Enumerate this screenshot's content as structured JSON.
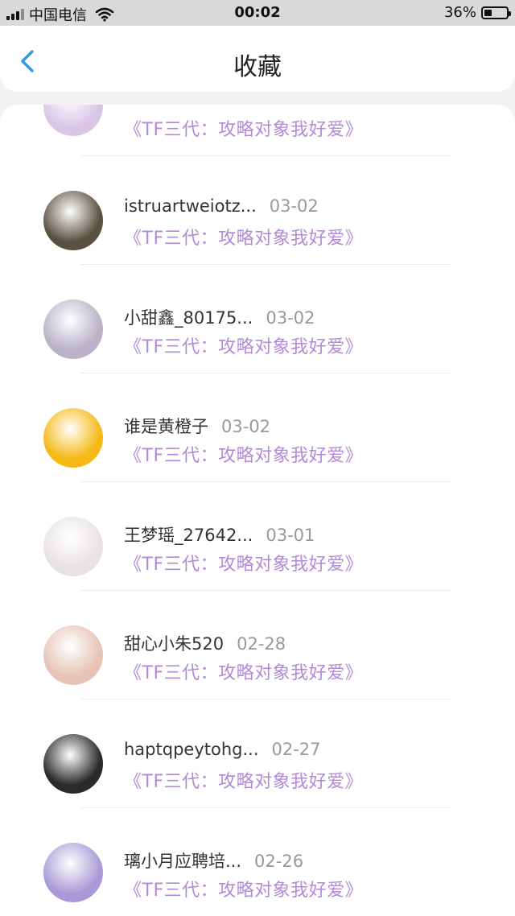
{
  "status_bar": {
    "carrier": "中国电信",
    "time": "00:02",
    "battery": "36%",
    "battery_level": 0.36
  },
  "header": {
    "title": "收藏"
  },
  "items": [
    {
      "name": "",
      "date": "",
      "book": "《TF三代：攻略对象我好爱》",
      "avatar_color": "#d9c6e6"
    },
    {
      "name": "istruartweiotz...",
      "date": "03-02",
      "book": "《TF三代：攻略对象我好爱》",
      "avatar_color": "#5a5040"
    },
    {
      "name": "小甜鑫_80175...",
      "date": "03-02",
      "book": "《TF三代：攻略对象我好爱》",
      "avatar_color": "#b9b2c8"
    },
    {
      "name": "谁是黄橙子",
      "date": "03-02",
      "book": "《TF三代：攻略对象我好爱》",
      "avatar_color": "#f5b915"
    },
    {
      "name": "王梦瑶_27642...",
      "date": "03-01",
      "book": "《TF三代：攻略对象我好爱》",
      "avatar_color": "#e8e2e6"
    },
    {
      "name": "甜心小朱520",
      "date": "02-28",
      "book": "《TF三代：攻略对象我好爱》",
      "avatar_color": "#e7c3b6"
    },
    {
      "name": "haptqpeytohg...",
      "date": "02-27",
      "book": "《TF三代：攻略对象我好爱》",
      "avatar_color": "#2a2a2a"
    },
    {
      "name": "璃小月应聘培...",
      "date": "02-26",
      "book": "《TF三代：攻略对象我好爱》",
      "avatar_color": "#a89ad6"
    }
  ]
}
